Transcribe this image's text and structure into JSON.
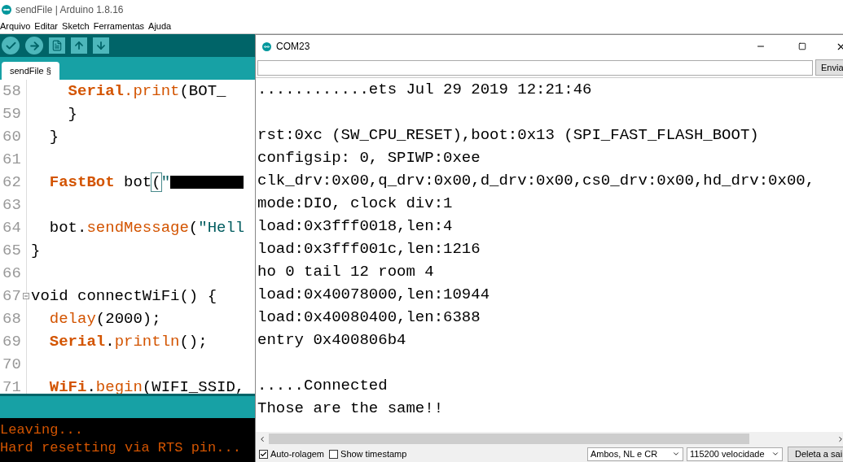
{
  "window": {
    "title": "sendFile | Arduino 1.8.16"
  },
  "menu": [
    "Arquivo",
    "Editar",
    "Sketch",
    "Ferramentas",
    "Ajuda"
  ],
  "toolbar": [
    {
      "kind": "verify"
    },
    {
      "kind": "upload"
    },
    {
      "kind": "new"
    },
    {
      "kind": "open"
    },
    {
      "kind": "save"
    }
  ],
  "tabs": [
    {
      "label": "sendFile §",
      "selected": true
    }
  ],
  "code_lines": [
    {
      "number": "58",
      "foldable": false,
      "segments": [
        {
          "kind": "keyword",
          "text": "    Serial"
        },
        {
          "kind": "function",
          "text": ".print"
        },
        {
          "kind": "plain",
          "text": "(BOT_"
        }
      ]
    },
    {
      "number": "59",
      "foldable": false,
      "segments": [
        {
          "kind": "plain",
          "text": "    }"
        }
      ]
    },
    {
      "number": "60",
      "foldable": false,
      "segments": [
        {
          "kind": "plain",
          "text": "  }"
        }
      ]
    },
    {
      "number": "61",
      "foldable": false
    },
    {
      "number": "62",
      "foldable": false,
      "segments": [
        {
          "kind": "keyword",
          "text": "  FastBot"
        },
        {
          "kind": "plain",
          "text": " bot"
        },
        {
          "kind": "matched_bracket",
          "text": "("
        },
        {
          "kind": "string",
          "text": "\""
        },
        {
          "kind": "redacted"
        }
      ]
    },
    {
      "number": "63",
      "foldable": false
    },
    {
      "number": "64",
      "foldable": false,
      "segments": [
        {
          "kind": "plain",
          "text": "  bot."
        },
        {
          "kind": "function",
          "text": "sendMessage"
        },
        {
          "kind": "plain",
          "text": "("
        },
        {
          "kind": "string",
          "text": "\"Hell"
        }
      ]
    },
    {
      "number": "65",
      "foldable": false,
      "segments": [
        {
          "kind": "plain",
          "text": "}"
        }
      ]
    },
    {
      "number": "66",
      "foldable": false
    },
    {
      "number": "67",
      "foldable": true,
      "segments": [
        {
          "kind": "plain",
          "text": "void connectWiFi() {"
        }
      ]
    },
    {
      "number": "68",
      "foldable": false,
      "segments": [
        {
          "kind": "function",
          "text": "  delay"
        },
        {
          "kind": "plain",
          "text": "(2000);"
        }
      ]
    },
    {
      "number": "69",
      "foldable": false,
      "segments": [
        {
          "kind": "keyword",
          "text": "  Serial"
        },
        {
          "kind": "plain",
          "text": "."
        },
        {
          "kind": "function",
          "text": "println"
        },
        {
          "kind": "plain",
          "text": "();"
        }
      ]
    },
    {
      "number": "70",
      "foldable": false
    },
    {
      "number": "71",
      "foldable": false,
      "segments": [
        {
          "kind": "keyword",
          "text": "  WiFi"
        },
        {
          "kind": "plain",
          "text": "."
        },
        {
          "kind": "function",
          "text": "begin"
        },
        {
          "kind": "plain",
          "text": "(WIFI_SSID,"
        }
      ]
    }
  ],
  "console": [
    "Leaving...",
    "Hard resetting via RTS pin..."
  ],
  "serial_monitor": {
    "title": "COM23",
    "send_button": "Envia",
    "output_blocks": [
      [
        "............ets Jul 29 2019 12:21:46"
      ],
      [
        "rst:0xc (SW_CPU_RESET),boot:0x13 (SPI_FAST_FLASH_BOOT)",
        "configsip: 0, SPIWP:0xee",
        "clk_drv:0x00,q_drv:0x00,d_drv:0x00,cs0_drv:0x00,hd_drv:0x00,",
        "mode:DIO, clock div:1",
        "load:0x3fff0018,len:4",
        "load:0x3fff001c,len:1216",
        "ho 0 tail 12 room 4",
        "load:0x40078000,len:10944",
        "load:0x40080400,len:6388",
        "entry 0x400806b4"
      ],
      [
        ".....Connected",
        "Those are the same!!"
      ]
    ],
    "options": [
      {
        "label": "Auto-rolagem",
        "checked": true
      },
      {
        "label": "Show timestamp",
        "checked": false
      }
    ],
    "line_ending": "Ambos, NL e CR",
    "baud_rate": "115200 velocidade",
    "clear_button": "Deleta a sai"
  }
}
